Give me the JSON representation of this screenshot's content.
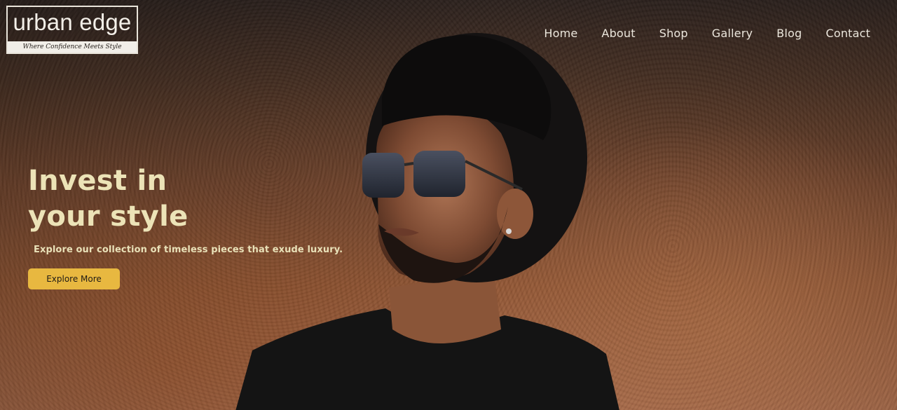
{
  "brand": {
    "name": "urban edge",
    "tagline": "Where Confidence Meets Style"
  },
  "nav": {
    "items": [
      {
        "label": "Home"
      },
      {
        "label": "About"
      },
      {
        "label": "Shop"
      },
      {
        "label": "Gallery"
      },
      {
        "label": "Blog"
      },
      {
        "label": "Contact"
      }
    ]
  },
  "hero": {
    "headline_line1": "Invest in",
    "headline_line2": "your style",
    "subtitle": "Explore our collection of timeless pieces that exude luxury.",
    "cta_label": "Explore More"
  },
  "colors": {
    "accent": "#e8b840",
    "headline": "#ece3b7",
    "nav_text": "#ece7dd"
  }
}
